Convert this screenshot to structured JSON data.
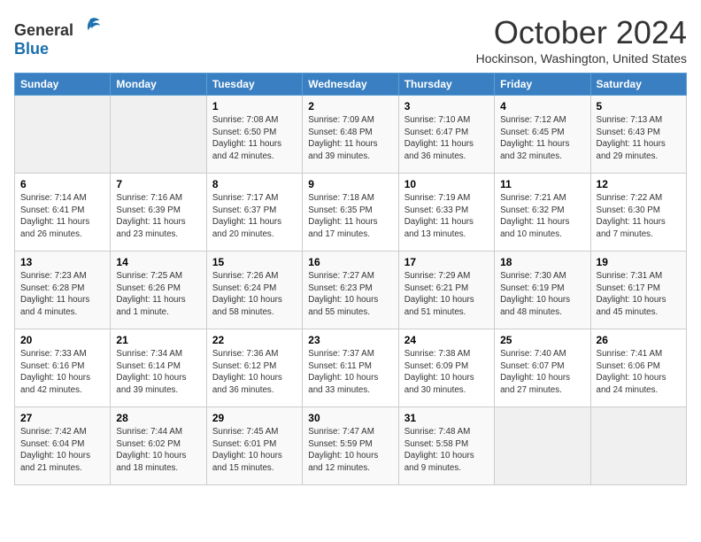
{
  "logo": {
    "general": "General",
    "blue": "Blue"
  },
  "header": {
    "month": "October 2024",
    "location": "Hockinson, Washington, United States"
  },
  "weekdays": [
    "Sunday",
    "Monday",
    "Tuesday",
    "Wednesday",
    "Thursday",
    "Friday",
    "Saturday"
  ],
  "weeks": [
    [
      {
        "day": "",
        "sunrise": "",
        "sunset": "",
        "daylight": ""
      },
      {
        "day": "",
        "sunrise": "",
        "sunset": "",
        "daylight": ""
      },
      {
        "day": "1",
        "sunrise": "Sunrise: 7:08 AM",
        "sunset": "Sunset: 6:50 PM",
        "daylight": "Daylight: 11 hours and 42 minutes."
      },
      {
        "day": "2",
        "sunrise": "Sunrise: 7:09 AM",
        "sunset": "Sunset: 6:48 PM",
        "daylight": "Daylight: 11 hours and 39 minutes."
      },
      {
        "day": "3",
        "sunrise": "Sunrise: 7:10 AM",
        "sunset": "Sunset: 6:47 PM",
        "daylight": "Daylight: 11 hours and 36 minutes."
      },
      {
        "day": "4",
        "sunrise": "Sunrise: 7:12 AM",
        "sunset": "Sunset: 6:45 PM",
        "daylight": "Daylight: 11 hours and 32 minutes."
      },
      {
        "day": "5",
        "sunrise": "Sunrise: 7:13 AM",
        "sunset": "Sunset: 6:43 PM",
        "daylight": "Daylight: 11 hours and 29 minutes."
      }
    ],
    [
      {
        "day": "6",
        "sunrise": "Sunrise: 7:14 AM",
        "sunset": "Sunset: 6:41 PM",
        "daylight": "Daylight: 11 hours and 26 minutes."
      },
      {
        "day": "7",
        "sunrise": "Sunrise: 7:16 AM",
        "sunset": "Sunset: 6:39 PM",
        "daylight": "Daylight: 11 hours and 23 minutes."
      },
      {
        "day": "8",
        "sunrise": "Sunrise: 7:17 AM",
        "sunset": "Sunset: 6:37 PM",
        "daylight": "Daylight: 11 hours and 20 minutes."
      },
      {
        "day": "9",
        "sunrise": "Sunrise: 7:18 AM",
        "sunset": "Sunset: 6:35 PM",
        "daylight": "Daylight: 11 hours and 17 minutes."
      },
      {
        "day": "10",
        "sunrise": "Sunrise: 7:19 AM",
        "sunset": "Sunset: 6:33 PM",
        "daylight": "Daylight: 11 hours and 13 minutes."
      },
      {
        "day": "11",
        "sunrise": "Sunrise: 7:21 AM",
        "sunset": "Sunset: 6:32 PM",
        "daylight": "Daylight: 11 hours and 10 minutes."
      },
      {
        "day": "12",
        "sunrise": "Sunrise: 7:22 AM",
        "sunset": "Sunset: 6:30 PM",
        "daylight": "Daylight: 11 hours and 7 minutes."
      }
    ],
    [
      {
        "day": "13",
        "sunrise": "Sunrise: 7:23 AM",
        "sunset": "Sunset: 6:28 PM",
        "daylight": "Daylight: 11 hours and 4 minutes."
      },
      {
        "day": "14",
        "sunrise": "Sunrise: 7:25 AM",
        "sunset": "Sunset: 6:26 PM",
        "daylight": "Daylight: 11 hours and 1 minute."
      },
      {
        "day": "15",
        "sunrise": "Sunrise: 7:26 AM",
        "sunset": "Sunset: 6:24 PM",
        "daylight": "Daylight: 10 hours and 58 minutes."
      },
      {
        "day": "16",
        "sunrise": "Sunrise: 7:27 AM",
        "sunset": "Sunset: 6:23 PM",
        "daylight": "Daylight: 10 hours and 55 minutes."
      },
      {
        "day": "17",
        "sunrise": "Sunrise: 7:29 AM",
        "sunset": "Sunset: 6:21 PM",
        "daylight": "Daylight: 10 hours and 51 minutes."
      },
      {
        "day": "18",
        "sunrise": "Sunrise: 7:30 AM",
        "sunset": "Sunset: 6:19 PM",
        "daylight": "Daylight: 10 hours and 48 minutes."
      },
      {
        "day": "19",
        "sunrise": "Sunrise: 7:31 AM",
        "sunset": "Sunset: 6:17 PM",
        "daylight": "Daylight: 10 hours and 45 minutes."
      }
    ],
    [
      {
        "day": "20",
        "sunrise": "Sunrise: 7:33 AM",
        "sunset": "Sunset: 6:16 PM",
        "daylight": "Daylight: 10 hours and 42 minutes."
      },
      {
        "day": "21",
        "sunrise": "Sunrise: 7:34 AM",
        "sunset": "Sunset: 6:14 PM",
        "daylight": "Daylight: 10 hours and 39 minutes."
      },
      {
        "day": "22",
        "sunrise": "Sunrise: 7:36 AM",
        "sunset": "Sunset: 6:12 PM",
        "daylight": "Daylight: 10 hours and 36 minutes."
      },
      {
        "day": "23",
        "sunrise": "Sunrise: 7:37 AM",
        "sunset": "Sunset: 6:11 PM",
        "daylight": "Daylight: 10 hours and 33 minutes."
      },
      {
        "day": "24",
        "sunrise": "Sunrise: 7:38 AM",
        "sunset": "Sunset: 6:09 PM",
        "daylight": "Daylight: 10 hours and 30 minutes."
      },
      {
        "day": "25",
        "sunrise": "Sunrise: 7:40 AM",
        "sunset": "Sunset: 6:07 PM",
        "daylight": "Daylight: 10 hours and 27 minutes."
      },
      {
        "day": "26",
        "sunrise": "Sunrise: 7:41 AM",
        "sunset": "Sunset: 6:06 PM",
        "daylight": "Daylight: 10 hours and 24 minutes."
      }
    ],
    [
      {
        "day": "27",
        "sunrise": "Sunrise: 7:42 AM",
        "sunset": "Sunset: 6:04 PM",
        "daylight": "Daylight: 10 hours and 21 minutes."
      },
      {
        "day": "28",
        "sunrise": "Sunrise: 7:44 AM",
        "sunset": "Sunset: 6:02 PM",
        "daylight": "Daylight: 10 hours and 18 minutes."
      },
      {
        "day": "29",
        "sunrise": "Sunrise: 7:45 AM",
        "sunset": "Sunset: 6:01 PM",
        "daylight": "Daylight: 10 hours and 15 minutes."
      },
      {
        "day": "30",
        "sunrise": "Sunrise: 7:47 AM",
        "sunset": "Sunset: 5:59 PM",
        "daylight": "Daylight: 10 hours and 12 minutes."
      },
      {
        "day": "31",
        "sunrise": "Sunrise: 7:48 AM",
        "sunset": "Sunset: 5:58 PM",
        "daylight": "Daylight: 10 hours and 9 minutes."
      },
      {
        "day": "",
        "sunrise": "",
        "sunset": "",
        "daylight": ""
      },
      {
        "day": "",
        "sunrise": "",
        "sunset": "",
        "daylight": ""
      }
    ]
  ]
}
